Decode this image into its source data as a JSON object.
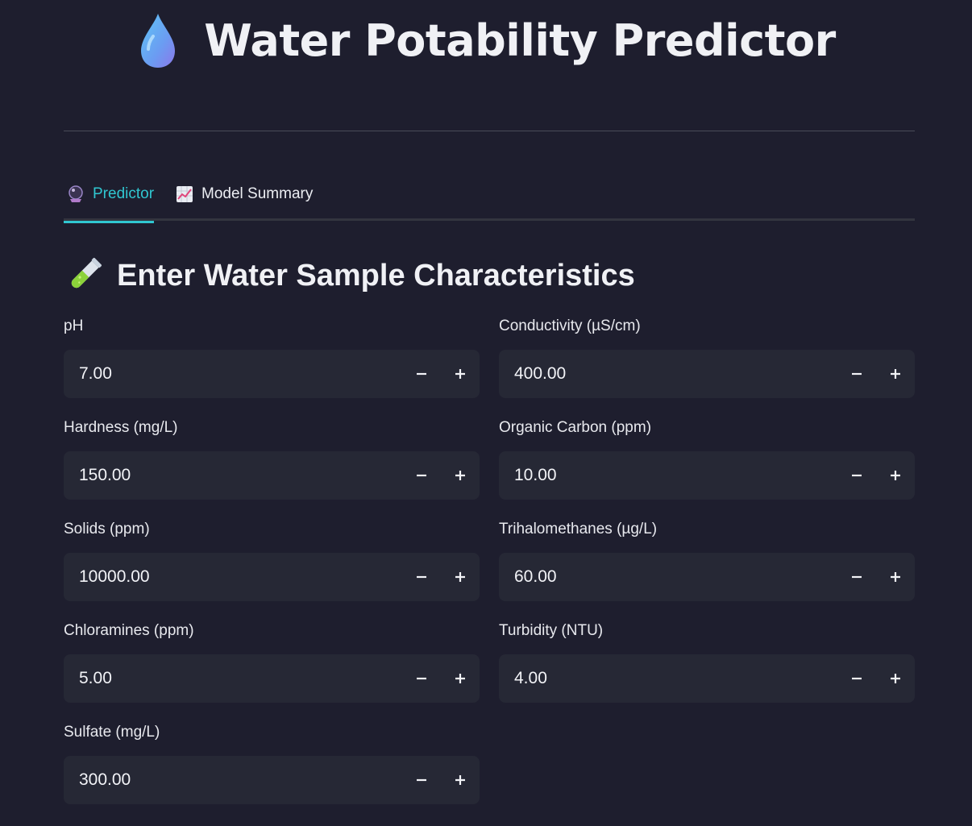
{
  "header": {
    "title": "Water Potability Predictor",
    "icon": "droplet-icon"
  },
  "tabs": [
    {
      "label": "Predictor",
      "icon": "crystal-ball-icon",
      "active": true
    },
    {
      "label": "Model Summary",
      "icon": "chart-increasing-icon",
      "active": false
    }
  ],
  "section": {
    "title": "Enter Water Sample Characteristics",
    "icon": "test-tube-icon"
  },
  "fields": {
    "ph": {
      "label": "pH",
      "value": "7.00"
    },
    "conductivity": {
      "label": "Conductivity (µS/cm)",
      "value": "400.00"
    },
    "hardness": {
      "label": "Hardness (mg/L)",
      "value": "150.00"
    },
    "organic_carbon": {
      "label": "Organic Carbon (ppm)",
      "value": "10.00"
    },
    "solids": {
      "label": "Solids (ppm)",
      "value": "10000.00"
    },
    "trihalomethanes": {
      "label": "Trihalomethanes (µg/L)",
      "value": "60.00"
    },
    "chloramines": {
      "label": "Chloramines (ppm)",
      "value": "5.00"
    },
    "turbidity": {
      "label": "Turbidity (NTU)",
      "value": "4.00"
    },
    "sulfate": {
      "label": "Sulfate (mg/L)",
      "value": "300.00"
    }
  },
  "colors": {
    "background": "#1e1e2e",
    "input_background": "#262835",
    "accent": "#30c7d1"
  }
}
